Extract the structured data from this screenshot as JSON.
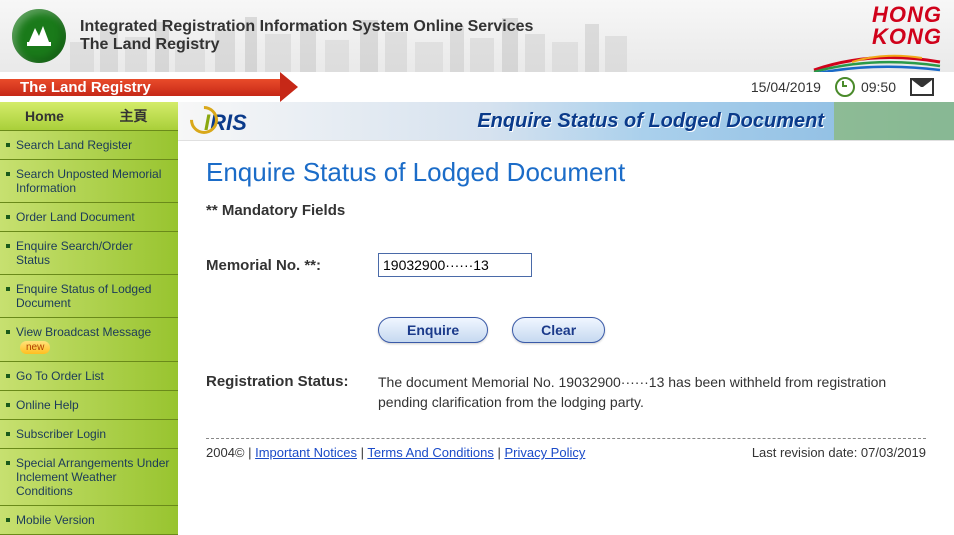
{
  "header": {
    "title1": "Integrated Registration Information System Online Services",
    "title2": "The Land Registry",
    "hk1": "HONG",
    "hk2": "KONG"
  },
  "bar": {
    "title": "The Land Registry",
    "date": "15/04/2019",
    "time": "09:50"
  },
  "tabs": {
    "home_en": "Home",
    "home_zh": "主頁"
  },
  "nav": [
    "Search Land Register",
    "Search Unposted Memorial Information",
    "Order Land Document",
    "Enquire Search/Order Status",
    "Enquire Status of Lodged Document",
    "View Broadcast Message",
    "Go To Order List",
    "Online Help",
    "Subscriber Login",
    "Special Arrangements Under Inclement Weather Conditions",
    "Mobile Version"
  ],
  "new_badge": "new",
  "banner_title": "Enquire Status of Lodged Document",
  "page": {
    "heading": "Enquire Status of Lodged Document",
    "mandatory": "** Mandatory Fields",
    "memorial_label": "Memorial No. **:",
    "memorial_value": "19032900······13",
    "enquire_btn": "Enquire",
    "clear_btn": "Clear",
    "status_label": "Registration Status:",
    "status_value": "The document Memorial No. 19032900······13 has been withheld from registration pending clarification from the lodging party."
  },
  "footer": {
    "copy": "2004© | ",
    "links": [
      "Important Notices",
      "Terms And Conditions",
      "Privacy Policy"
    ],
    "sep1": " | ",
    "sep2": " | ",
    "revision": "Last revision date: 07/03/2019"
  }
}
